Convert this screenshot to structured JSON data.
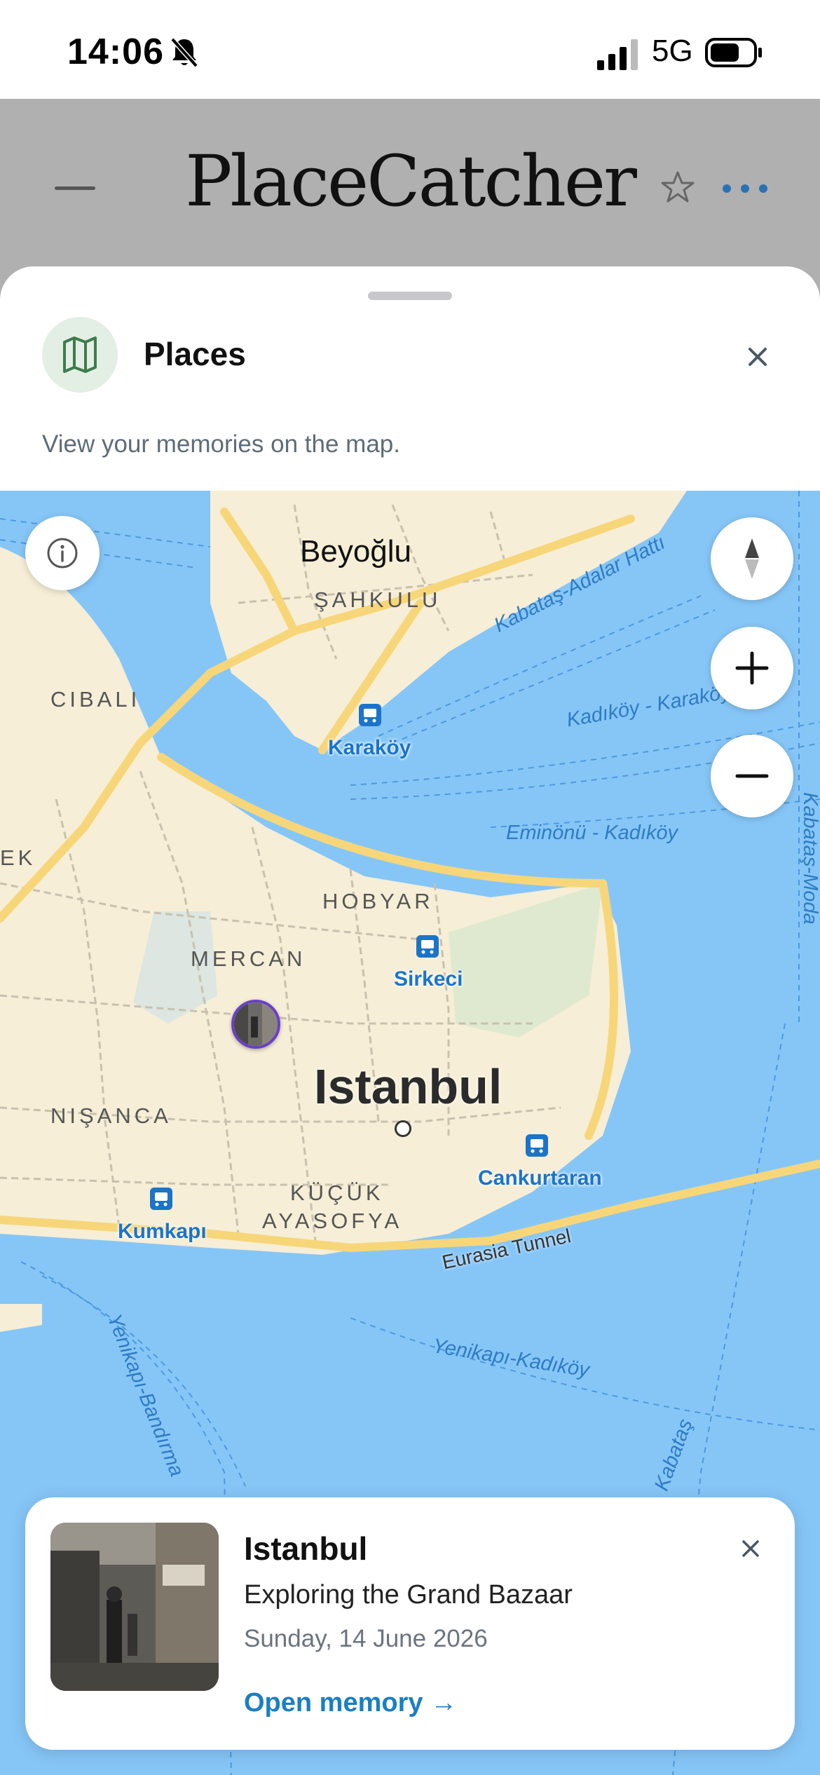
{
  "status_bar": {
    "time": "14:06",
    "network": "5G"
  },
  "header": {
    "app_title": "PlaceCatcher"
  },
  "sheet": {
    "title": "Places",
    "subtitle": "View your memories on the map."
  },
  "map": {
    "districts": [
      "Beyoğlu",
      "ŞAHKULU",
      "CIBALI",
      "EK",
      "HOBYAR",
      "MERCAN",
      "NIŞANCA",
      "KÜÇÜK",
      "AYASOFYA"
    ],
    "city": "Istanbul",
    "stations": [
      "Karaköy",
      "Sirkeci",
      "Cankurtaran",
      "Kumkapı"
    ],
    "water_labels": [
      "Kabataş-Adalar Hattı",
      "Kadıköy - Karaköy",
      "Eminönü - Kadıköy",
      "Kabataş-Moda",
      "Eurasia Tunnel",
      "Yenikapı-Kadıköy",
      "Yenikapı-Bandırma",
      "Kabataş"
    ],
    "colors": {
      "water": "#86c6f7",
      "land": "#f6eed6",
      "road_major": "#f7d67a",
      "park": "#d8e6cc",
      "station": "#1b74c9"
    }
  },
  "card": {
    "title": "Istanbul",
    "description": "Exploring the Grand Bazaar",
    "date": "Sunday, 14 June 2026",
    "link": "Open memory →"
  }
}
